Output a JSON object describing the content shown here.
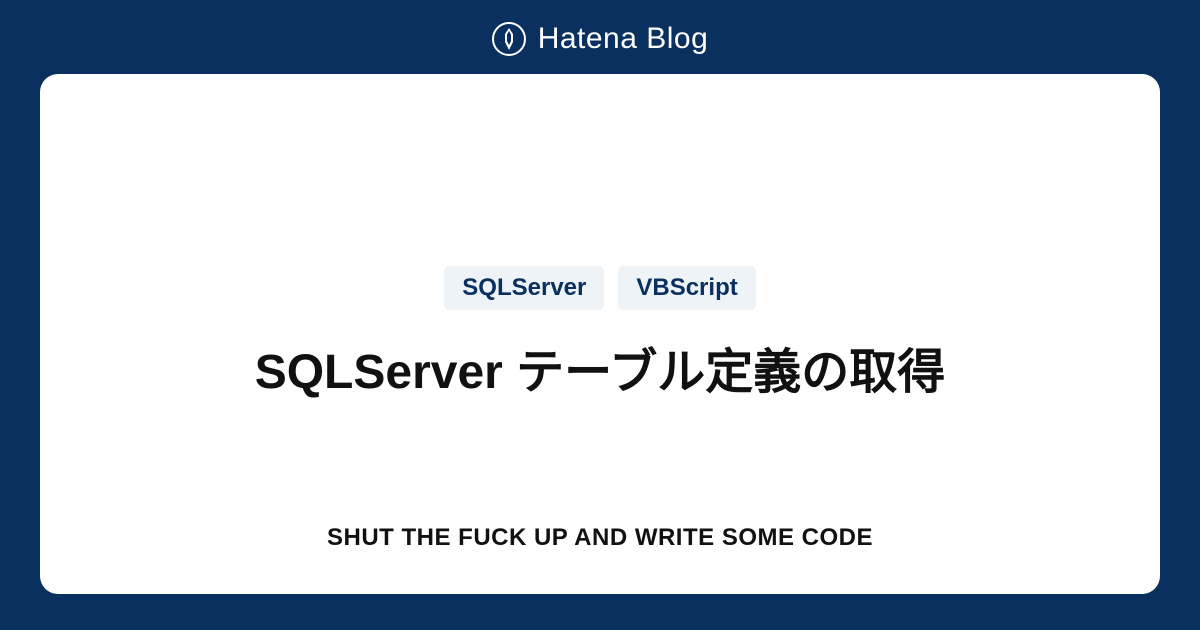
{
  "header": {
    "brand": "Hatena Blog"
  },
  "card": {
    "tags": [
      "SQLServer",
      "VBScript"
    ],
    "title": "SQLServer テーブル定義の取得",
    "blog_title": "SHUT THE FUCK UP AND WRITE SOME CODE"
  }
}
